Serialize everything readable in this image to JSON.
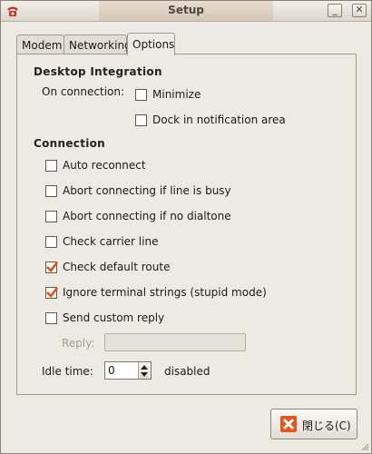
{
  "window": {
    "title": "Setup"
  },
  "tabs": [
    {
      "label": "Modem",
      "active": false
    },
    {
      "label": "Networking",
      "active": false
    },
    {
      "label": "Options",
      "active": true
    }
  ],
  "desktop_integration": {
    "heading": "Desktop Integration",
    "on_connection_label": "On connection:",
    "minimize": {
      "label": "Minimize",
      "checked": false
    },
    "dock": {
      "label": "Dock in notification area",
      "checked": false
    }
  },
  "connection": {
    "heading": "Connection",
    "options": [
      {
        "label": "Auto reconnect",
        "checked": false
      },
      {
        "label": "Abort connecting if line is busy",
        "checked": false
      },
      {
        "label": "Abort connecting if no dialtone",
        "checked": false
      },
      {
        "label": "Check carrier line",
        "checked": false
      },
      {
        "label": "Check default route",
        "checked": true
      },
      {
        "label": "Ignore terminal strings (stupid mode)",
        "checked": true
      },
      {
        "label": "Send custom reply",
        "checked": false
      }
    ],
    "reply_label": "Reply:",
    "reply_value": "",
    "idle_time_label": "Idle time:",
    "idle_time_value": "0",
    "idle_status": "disabled"
  },
  "footer": {
    "close_label": "閉じる(C)"
  },
  "colors": {
    "check": "#d9531e",
    "close_icon": "#e8541c"
  }
}
